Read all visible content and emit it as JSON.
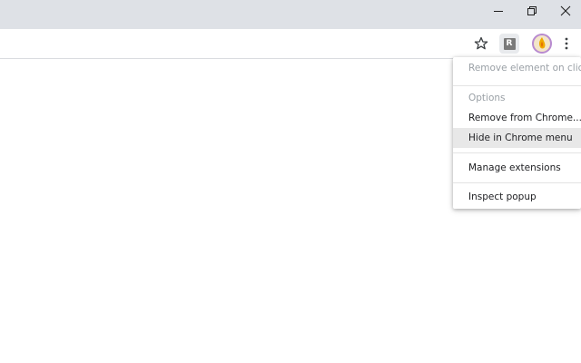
{
  "window_controls": {
    "minimize_label": "minimize",
    "restore_label": "restore",
    "close_label": "close"
  },
  "toolbar": {
    "extension_badge": "R",
    "icons": [
      "star-icon",
      "extension-icon",
      "profile-avatar",
      "kebab-menu-icon"
    ]
  },
  "context_menu": {
    "items": [
      {
        "label": "Remove element on click",
        "state": "disabled"
      },
      {
        "label": "Options",
        "state": "disabled"
      },
      {
        "label": "Remove from Chrome...",
        "state": "normal"
      },
      {
        "label": "Hide in Chrome menu",
        "state": "highlighted"
      },
      {
        "label": "Manage extensions",
        "state": "normal"
      },
      {
        "label": "Inspect popup",
        "state": "normal"
      }
    ]
  },
  "colors": {
    "titlebar": "#dee1e6",
    "highlight": "#e8e8e8",
    "disabled_text": "#9aa0a6",
    "text": "#202124"
  }
}
